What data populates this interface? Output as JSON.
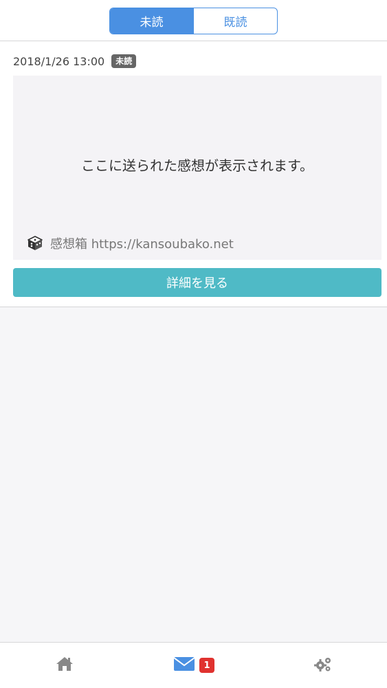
{
  "header": {
    "segments": [
      {
        "label": "未読",
        "active": true
      },
      {
        "label": "既読",
        "active": false
      }
    ]
  },
  "message": {
    "timestamp": "2018/1/26 13:00",
    "status_badge": "未読",
    "preview_text": "ここに送られた感想が表示されます。",
    "source_label": "感想箱 https://kansoubako.net",
    "detail_button_label": "詳細を見る"
  },
  "tabbar": {
    "home_icon": "home-icon",
    "mail_icon": "mail-icon",
    "mail_badge": "1",
    "settings_icon": "gears-icon"
  },
  "colors": {
    "accent": "#4a90e2",
    "button": "#4fbac6",
    "badge_red": "#e0322f",
    "badge_gray": "#666666",
    "background": "#f6f6f8"
  }
}
